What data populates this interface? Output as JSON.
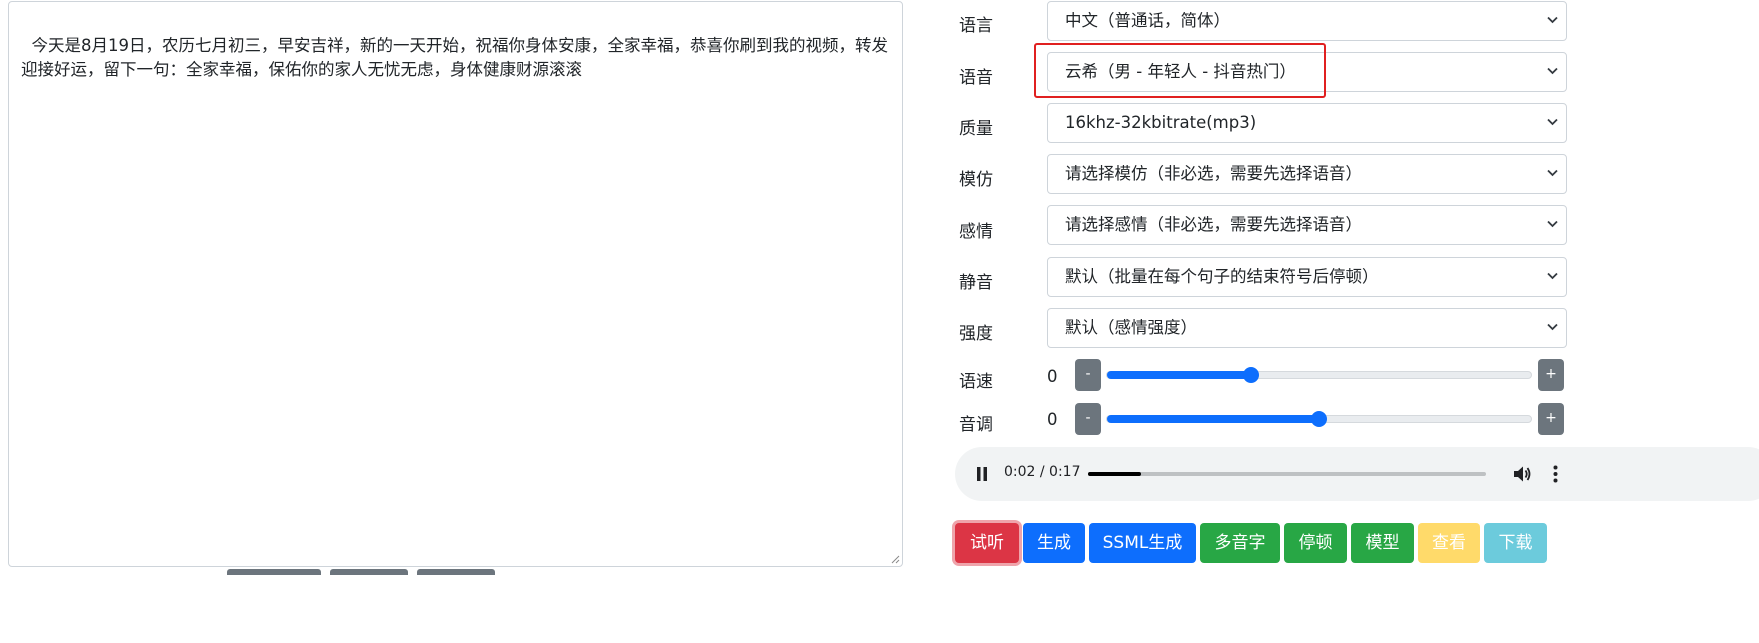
{
  "editor": {
    "text": "今天是8月19日，农历七月初三，早安吉祥，新的一天开始，祝福你身体安康，全家幸福，恭喜你刷到我的视频，转发迎接好运，留下一句：全家幸福，保佑你的家人无忧无虑，身体健康财源滚滚"
  },
  "form": {
    "language": {
      "label": "语言",
      "value": "中文（普通话，简体）"
    },
    "voice": {
      "label": "语音",
      "value": "云希（男 - 年轻人 - 抖音热门）"
    },
    "quality": {
      "label": "质量",
      "value": "16khz-32kbitrate(mp3)"
    },
    "imitate": {
      "label": "模仿",
      "value": "请选择模仿（非必选，需要先选择语音）"
    },
    "emotion": {
      "label": "感情",
      "value": "请选择感情（非必选，需要先选择语音）"
    },
    "silence": {
      "label": "静音",
      "value": "默认（批量在每个句子的结束符号后停顿）"
    },
    "intensity": {
      "label": "强度",
      "value": "默认（感情强度）"
    },
    "rate": {
      "label": "语速",
      "value": "0",
      "decrement": "-",
      "increment": "+",
      "level_fraction": 0.34
    },
    "pitch": {
      "label": "音调",
      "value": "0",
      "decrement": "-",
      "increment": "+",
      "level_fraction": 0.5
    }
  },
  "player": {
    "time": "0:02 / 0:17",
    "progress_fraction": 0.133,
    "icons": [
      "pause-icon",
      "volume-icon",
      "more-vert-icon"
    ]
  },
  "actions": {
    "preview": "试听",
    "generate": "生成",
    "ssml_generate": "SSML生成",
    "polyphone": "多音字",
    "pause": "停顿",
    "model": "模型",
    "view": "查看",
    "download": "下载"
  },
  "colors": {
    "danger": "#dc3545",
    "primary": "#0d6efd",
    "success": "#28a745",
    "warning": "#ffda6a",
    "info": "#6ccbdc",
    "secondary": "#6c757d",
    "highlight": "#e02020"
  }
}
